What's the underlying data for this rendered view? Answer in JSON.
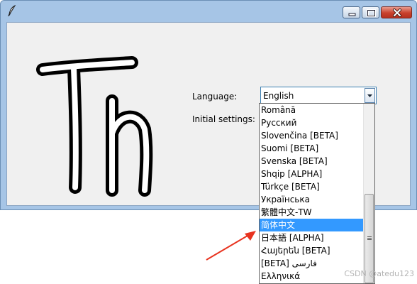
{
  "window": {
    "title": ""
  },
  "labels": {
    "language": "Language:",
    "initial_settings": "Initial settings:"
  },
  "language_combo": {
    "value": "English"
  },
  "dropdown": {
    "items": [
      "Română",
      "Русский",
      "Slovenčina [BETA]",
      "Suomi [BETA]",
      "Svenska [BETA]",
      "Shqip [ALPHA]",
      "Türkçe [BETA]",
      "Українська",
      "繁體中文-TW",
      "简体中文",
      "日本語  [ALPHA]",
      "Հայերեն [BETA]",
      "[BETA] فارسی",
      "Ελληνικά"
    ],
    "selected_index": 9
  },
  "watermark": "CSDN @atedu123",
  "colors": {
    "selection": "#3399ff",
    "arrow": "#e8331f",
    "window_frame": "#a6c5e6"
  },
  "icons": {
    "app": "feather-icon",
    "minimize": "minimize-icon",
    "maximize": "maximize-icon",
    "close": "close-icon",
    "dropdown": "chevron-down-icon"
  }
}
